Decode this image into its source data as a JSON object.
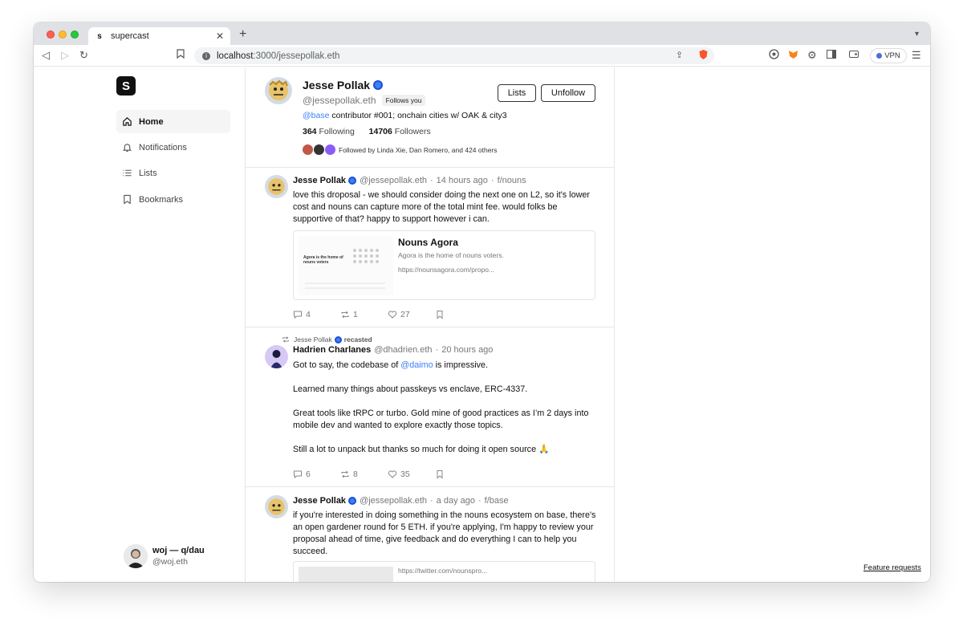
{
  "browser": {
    "tab_title": "supercast",
    "tab_favicon": "s",
    "url_host": "localhost",
    "url_path": ":3000/jessepollak.eth",
    "vpn_label": "VPN"
  },
  "app": {
    "logo_letter": "S",
    "nav": [
      {
        "label": "Home",
        "icon": "home-icon",
        "active": true
      },
      {
        "label": "Notifications",
        "icon": "bell-icon"
      },
      {
        "label": "Lists",
        "icon": "list-icon"
      },
      {
        "label": "Bookmarks",
        "icon": "bookmark-icon"
      }
    ],
    "user": {
      "name": "woj — q/dau",
      "handle": "@woj.eth"
    },
    "feature_requests": "Feature requests"
  },
  "profile": {
    "name": "Jesse Pollak",
    "handle": "@jessepollak.eth",
    "follows_you": "Follows you",
    "bio_link": "@base",
    "bio_text": " contributor #001; onchain cities w/ OAK & city3",
    "following_count": "364",
    "following_label": "Following",
    "followers_count": "14706",
    "followers_label": "Followers",
    "followed_by": "Followed by Linda Xie, Dan Romero, and 424 others",
    "lists_button": "Lists",
    "unfollow_button": "Unfollow"
  },
  "casts": [
    {
      "name": "Jesse Pollak",
      "handle": "@jessepollak.eth",
      "time": "14 hours ago",
      "channel": "f/nouns",
      "body": "love this droposal - we should consider doing the next one on L2, so it's lower cost and nouns can capture more of the total mint fee. would folks be supportive of that? happy to support however i can.",
      "embed": {
        "title": "Nouns Agora",
        "description": "Agora is the home of nouns voters.",
        "url": "https://nounsagora.com/propo...",
        "thumb_text": "Agora is the home of nouns voters"
      },
      "replies": "4",
      "recasts": "1",
      "likes": "27"
    },
    {
      "recast_by": "Jesse Pollak",
      "recast_label": "recasted",
      "name": "Hadrien Charlanes",
      "handle": "@dhadrien.eth",
      "time": "20 hours ago",
      "body_p1_pre": "Got to say, the codebase of ",
      "body_p1_link": "@daimo",
      "body_p1_post": " is impressive.",
      "body_p2": "Learned many things about passkeys vs enclave, ERC-4337.",
      "body_p3": "Great tools like tRPC or turbo. Gold mine of good practices as I’m 2 days into mobile dev and wanted to explore exactly those topics.",
      "body_p4": "Still a lot to unpack but thanks so much for doing it open source 🙏",
      "replies": "6",
      "recasts": "8",
      "likes": "35"
    },
    {
      "name": "Jesse Pollak",
      "handle": "@jessepollak.eth",
      "time": "a day ago",
      "channel": "f/base",
      "body": "if you're interested in doing something in the nouns ecosystem on base, there's an open gardener round for 5 ETH. if you're applying, I'm happy to review your proposal ahead of time, give feedback and do everything I can to help you succeed.",
      "embed_url": "https://twitter.com/nounspro..."
    }
  ],
  "separator": "·",
  "colors": {
    "accent": "#3b82f6",
    "verified": "#3b82f6",
    "border": "#e7e7e7"
  }
}
